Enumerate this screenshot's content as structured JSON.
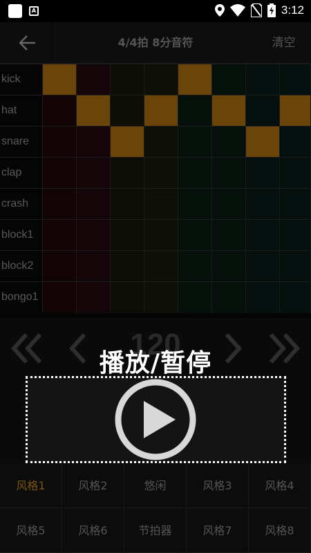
{
  "status_bar": {
    "time": "3:12",
    "notif_letter": "A"
  },
  "app_bar": {
    "back_icon": "arrow-left-icon",
    "title": "4/4拍 8分音符",
    "clear_label": "清空"
  },
  "tracks": [
    {
      "name": "kick",
      "steps": [
        1,
        0,
        0,
        0,
        1,
        0,
        0,
        0
      ]
    },
    {
      "name": "hat",
      "steps": [
        0,
        1,
        0,
        1,
        0,
        1,
        0,
        1
      ]
    },
    {
      "name": "snare",
      "steps": [
        0,
        0,
        1,
        0,
        0,
        0,
        1,
        0
      ]
    },
    {
      "name": "clap",
      "steps": [
        0,
        0,
        0,
        0,
        0,
        0,
        0,
        0
      ]
    },
    {
      "name": "crash",
      "steps": [
        0,
        0,
        0,
        0,
        0,
        0,
        0,
        0
      ]
    },
    {
      "name": "block1",
      "steps": [
        0,
        0,
        0,
        0,
        0,
        0,
        0,
        0
      ]
    },
    {
      "name": "block2",
      "steps": [
        0,
        0,
        0,
        0,
        0,
        0,
        0,
        0
      ]
    },
    {
      "name": "bongo1",
      "steps": [
        0,
        0,
        0,
        0,
        0,
        0,
        0,
        0
      ]
    }
  ],
  "column_tints": [
    "#130506",
    "#150709",
    "#0d0f06",
    "#0e0f06",
    "#06100a",
    "#06100b",
    "#040f0e",
    "#040f0e"
  ],
  "active_step_color": "#6a4408",
  "transport": {
    "bpm": "120",
    "play_label": "播放/暂停"
  },
  "styles": {
    "active_index": 0,
    "items": [
      "风格1",
      "风格2",
      "悠闲",
      "风格3",
      "风格4",
      "风格5",
      "风格6",
      "节拍器",
      "风格7",
      "风格8"
    ]
  }
}
